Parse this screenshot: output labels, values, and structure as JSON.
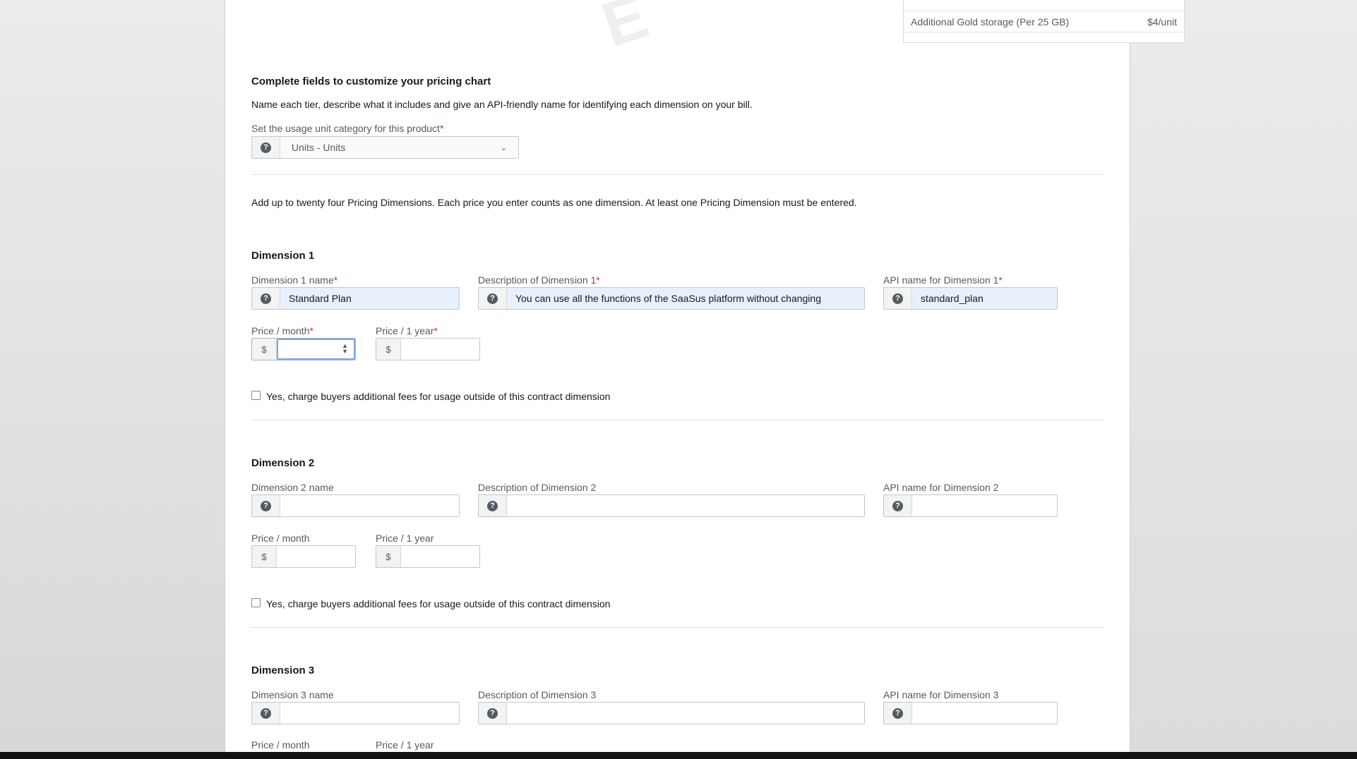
{
  "pricing_table": {
    "rows": [
      {
        "label": "Additional Gold storage (Per 25 GB)",
        "value": "$4/unit"
      }
    ]
  },
  "customize": {
    "heading": "Complete fields to customize your pricing chart",
    "description": "Name each tier, describe what it includes and give an API-friendly name for identifying each dimension on your bill.",
    "unit_category_label": "Set the usage unit category for this product",
    "unit_category_value": "Units - Units"
  },
  "dimensions_intro": "Add up to twenty four Pricing Dimensions. Each price you enter counts as one dimension. At least one Pricing Dimension must be entered.",
  "dimensions": [
    {
      "title": "Dimension 1",
      "name_label": "Dimension 1 name",
      "name_value": "Standard Plan",
      "desc_label": "Description of Dimension 1",
      "desc_value": "You can use all the functions of the SaaSus platform without changing",
      "api_label": "API name for Dimension 1",
      "api_value": "standard_plan",
      "month_label": "Price / month",
      "year_label": "Price / 1 year",
      "month_value": "",
      "year_value": "",
      "checkbox_label": "Yes, charge buyers additional fees for usage outside of this contract dimension",
      "required": true
    },
    {
      "title": "Dimension 2",
      "name_label": "Dimension 2 name",
      "name_value": "",
      "desc_label": "Description of Dimension 2",
      "desc_value": "",
      "api_label": "API name for Dimension 2",
      "api_value": "",
      "month_label": "Price / month",
      "year_label": "Price / 1 year",
      "month_value": "",
      "year_value": "",
      "checkbox_label": "Yes, charge buyers additional fees for usage outside of this contract dimension",
      "required": false
    },
    {
      "title": "Dimension 3",
      "name_label": "Dimension 3 name",
      "name_value": "",
      "desc_label": "Description of Dimension 3",
      "desc_value": "",
      "api_label": "API name for Dimension 3",
      "api_value": "",
      "month_label": "Price / month",
      "year_label": "Price / 1 year",
      "required": false
    }
  ],
  "symbols": {
    "help": "?",
    "dollar": "$",
    "required_mark": "*"
  },
  "icons": {
    "help": "help-circle-icon",
    "select_arrow": "chevron-down-icon",
    "spinner": "number-spinner-icon"
  },
  "colors": {
    "required": "#d13212",
    "autofill": "#e8f0fe",
    "focus_ring": "#79a8e8"
  }
}
